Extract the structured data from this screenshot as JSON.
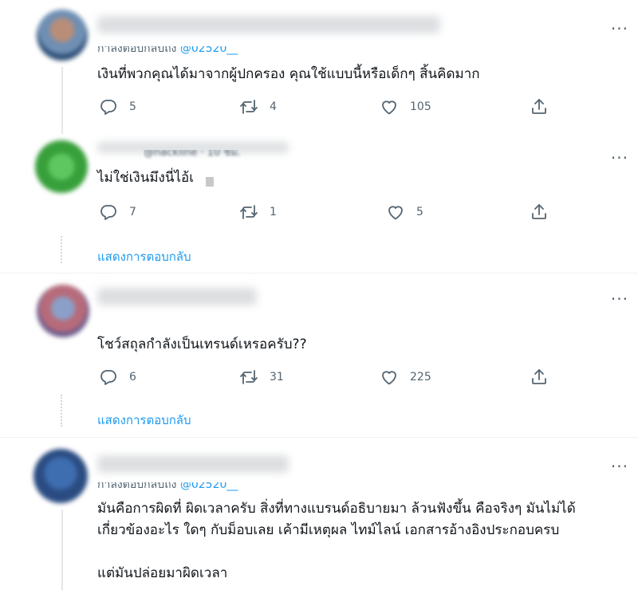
{
  "tweets": [
    {
      "replying_to": "กำลังตอบกลับถึง",
      "handle": "@02520__",
      "text": "เงินที่พวกคุณได้มาจากผู้ปกครอง คุณใช้แบบนี้หรือเด็กๆ สิ้นคิดมาก",
      "replies": "5",
      "retweets": "4",
      "likes": "105"
    },
    {
      "header": "@nackline · 10 ชม.",
      "text": "ไม่ใช่เงินมึงนี่ไอ้เ",
      "replies": "7",
      "retweets": "1",
      "likes": "5",
      "show_replies": "แสดงการตอบกลับ"
    },
    {
      "text": "โชว์สถุลกำลังเป็นเทรนด์เหรอครับ??",
      "replies": "6",
      "retweets": "31",
      "likes": "225",
      "show_replies": "แสดงการตอบกลับ"
    },
    {
      "replying_to": "กำลังตอบกลับถึง",
      "handle": "@02520__",
      "text_line1": "มันคือการผิดที่ ผิดเวลาครับ สิ่งที่ทางแบรนด์อธิบายมา ล้วนฟังขึ้น คือจริงๆ มันไม่ได้",
      "text_line2": "เกี่ยวข้องอะไร ใดๆ กับม็อบเลย เค้ามีเหตุผล ไทม์ไลน์ เอกสารอ้างอิงประกอบครบ",
      "text_line3": "แต่มันปล่อยมาผิดเวลา"
    }
  ],
  "more_label": "···",
  "colors": {
    "accent": "#1d9bf0",
    "secondary_text": "#536471",
    "divider": "#eff3f4"
  },
  "icons": [
    "reply-icon",
    "retweet-icon",
    "like-icon",
    "share-icon",
    "more-icon"
  ]
}
